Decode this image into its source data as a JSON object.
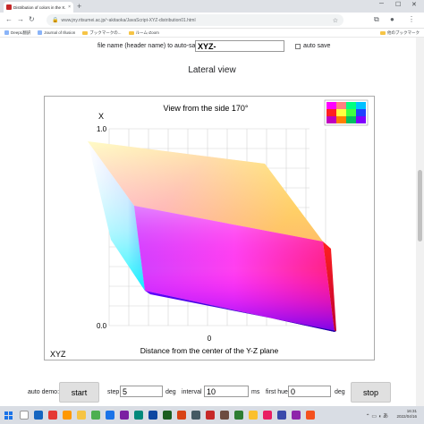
{
  "browser": {
    "tab_title": "Distribution of colors in the X...",
    "tab_close": "×",
    "new_tab": "+",
    "url": "www.jny.ritsumei.ac.jp/~akitaoka/JavaScript-XYZ-distribution01.html",
    "bookmarks": [
      "DeepL翻訳",
      "Journal of Illusion",
      "ブックマークの...",
      "ルーム-Zoom"
    ],
    "other_bookmarks": "他のブックマーク"
  },
  "form": {
    "filename_label": "file name (header name) to auto-save",
    "filename_value": "XYZ-",
    "autosave_label": "auto save"
  },
  "section_title": "Lateral view",
  "chart": {
    "title": "View from the side 170°",
    "y_axis_label": "X",
    "y_top": "1.0",
    "y_bottom": "0.0",
    "x_tick": "0",
    "x_axis_label": "Distance from the center of the Y-Z plane",
    "corner_label": "XYZ",
    "view_angle_deg": 170
  },
  "controls": {
    "auto_demo_label": "auto demo:",
    "start_label": "start",
    "step_label": "step",
    "step_value": "5",
    "deg_label_1": "deg",
    "interval_label": "interval",
    "interval_value": "10",
    "ms_label": "ms",
    "first_hue_label": "first hue",
    "first_hue_value": "0",
    "deg_label_2": "deg",
    "stop_label": "stop"
  },
  "taskbar": {
    "time": "16:31",
    "date": "2022/04/16"
  },
  "colors": {
    "cube_top": "#ffff00",
    "cube_front": "#ff00ff",
    "cube_left": "#ffffff",
    "cube_right": "#ff0000",
    "cube_bottom": "#0000ff"
  }
}
